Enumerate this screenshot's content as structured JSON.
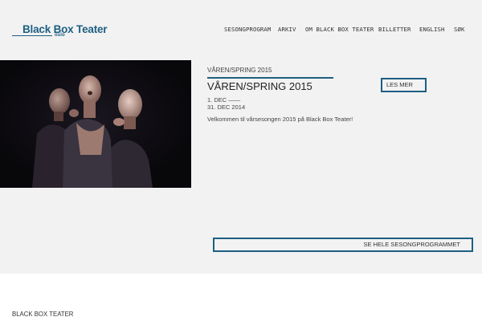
{
  "header": {
    "logo_text": "Black Box Teater",
    "logo_sub": "oslo",
    "nav": [
      {
        "label": "SESONGPROGRAM"
      },
      {
        "label": "ARKIV"
      },
      {
        "label": "OM BLACK BOX TEATER"
      },
      {
        "label": "BILLETTER"
      },
      {
        "label": "ENGLISH"
      },
      {
        "label": "SØK"
      }
    ]
  },
  "feature": {
    "kicker": "VÅREN/SPRING 2015",
    "title": "VÅREN/SPRING 2015",
    "date_start": "1. DEC ——",
    "date_end": "31. DEC 2014",
    "description": "Velkommen til vårsesongen 2015 på Black Box Teater!",
    "read_more": "LES MER"
  },
  "program_button": "SE HELE SESONGPROGRAMMET",
  "footer": {
    "title": "BLACK BOX TEATER"
  },
  "colors": {
    "accent": "#1d5f82",
    "background": "#f2f2f2",
    "footer_bg": "#ffffff"
  }
}
